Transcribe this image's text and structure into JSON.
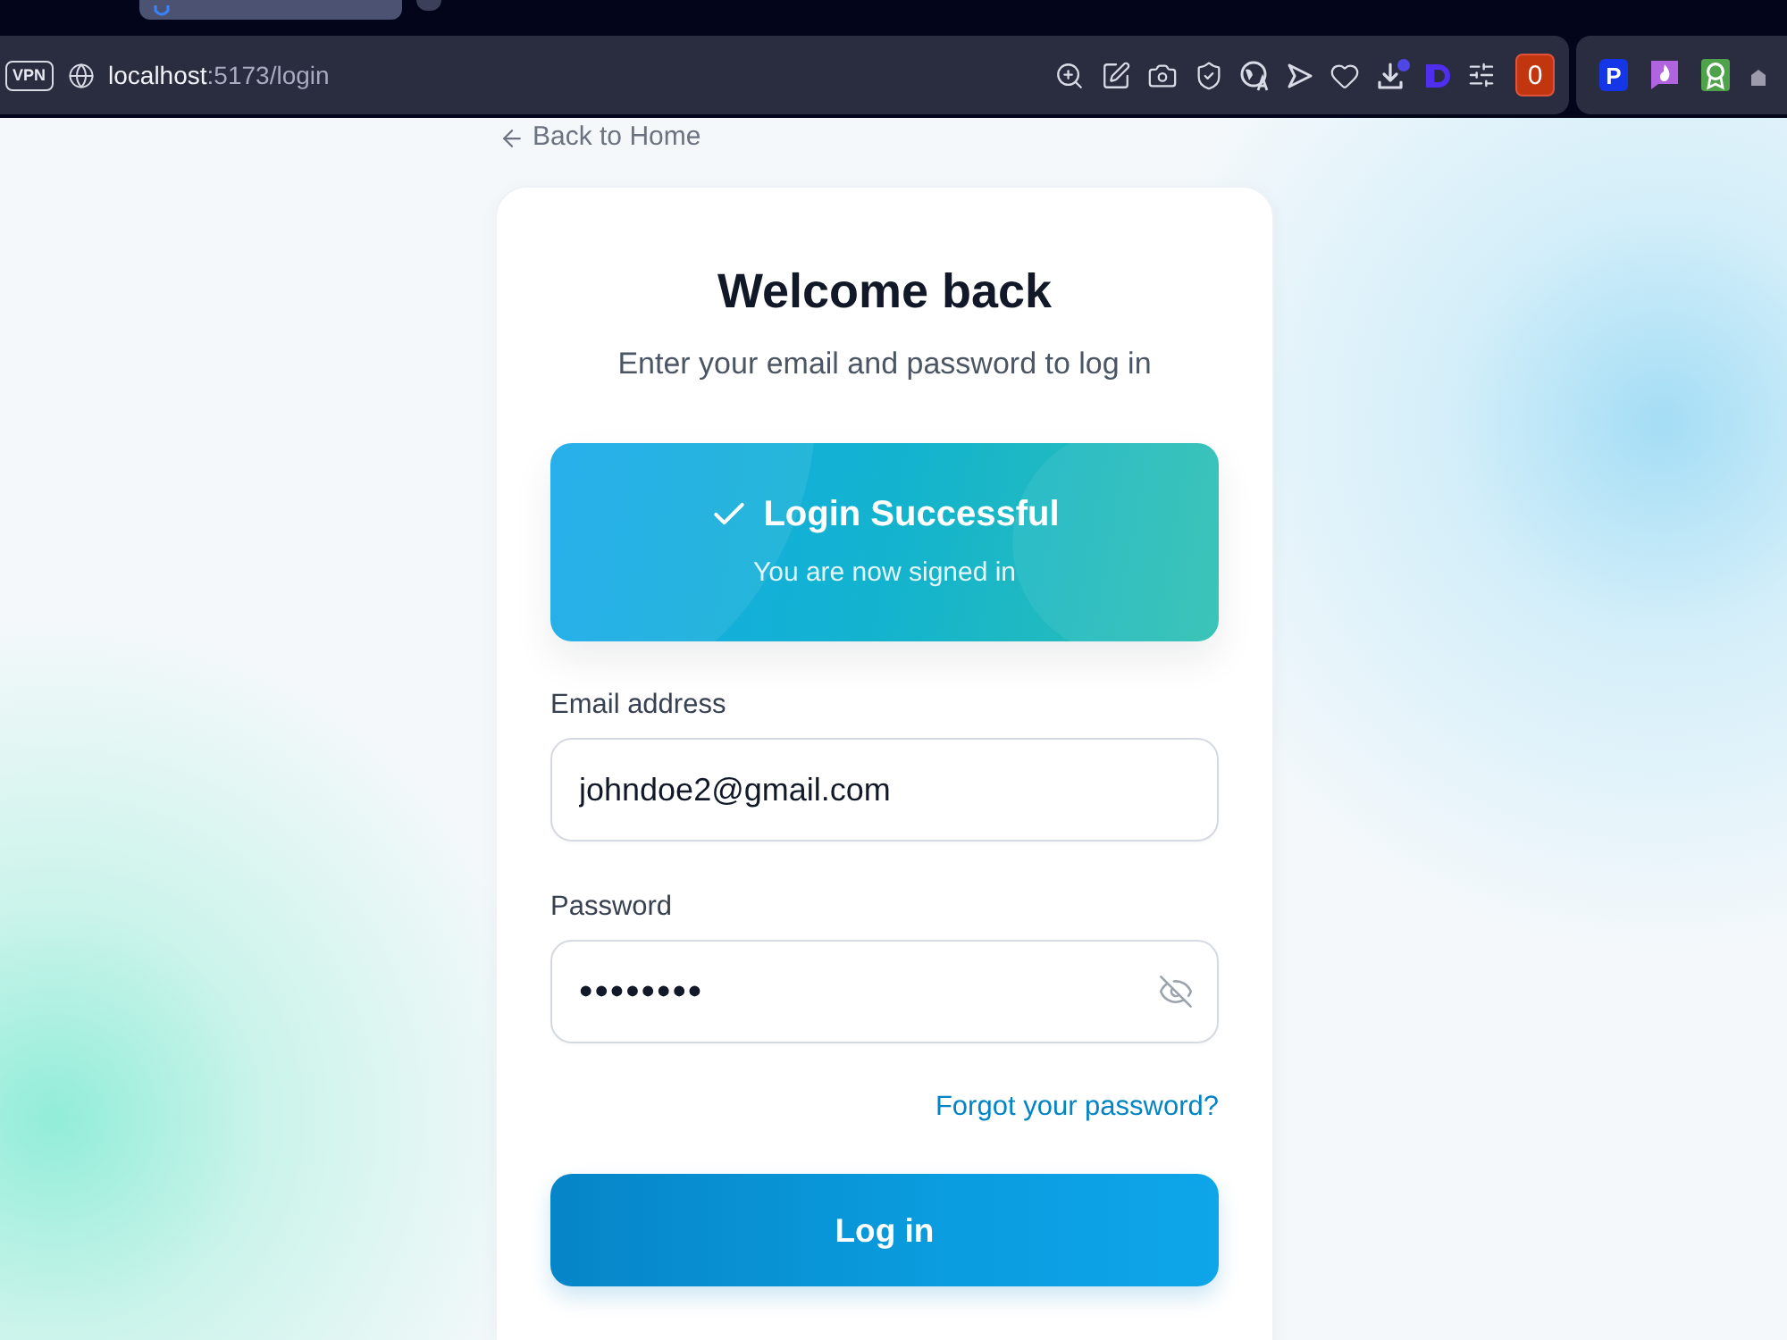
{
  "browser": {
    "address_bar": {
      "vpn_label": "VPN",
      "url_host": "localhost",
      "url_path": ":5173/login"
    },
    "toolbar_badge": "0",
    "extension_letter": "P"
  },
  "page": {
    "back_link": "Back to Home",
    "card": {
      "title": "Welcome back",
      "subtitle": "Enter your email and password to log in",
      "alert": {
        "kind": "success",
        "title": "Login Successful",
        "message": "You are now signed in"
      },
      "fields": [
        {
          "kind": "email",
          "label": "Email address",
          "value": "johndoe2@gmail.com"
        },
        {
          "kind": "password",
          "label": "Password",
          "value": "••••••••",
          "show_password": false
        }
      ],
      "forgot_link": "Forgot your password?",
      "submit_button": "Log in"
    }
  }
}
